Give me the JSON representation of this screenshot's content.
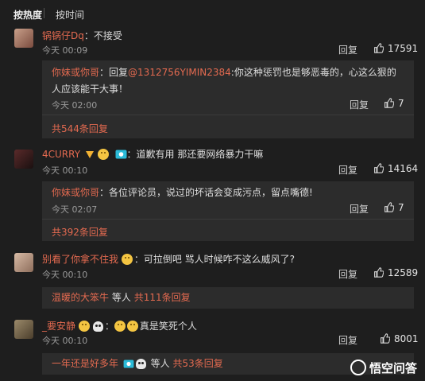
{
  "sort_tabs": {
    "hot": "按热度",
    "time": "按时间"
  },
  "comments": [
    {
      "name": "锅锅仔Dq",
      "colon": "：",
      "text": "不接受",
      "time": "今天 00:09",
      "reply_label": "回复",
      "likes": "17591",
      "reply_box": {
        "author": "你妹或你哥",
        "colon": "：",
        "prefix": "回复",
        "mention": "@1312756YIMIN2384",
        "text": ":你这种惩罚也是够恶毒的，心这么狠的人应该能干大事！",
        "time": "今天 02:00",
        "reply_label": "回复",
        "likes": "7",
        "total": "共544条回复"
      }
    },
    {
      "name": "4CURRY",
      "colon": "：",
      "text": "道歉有用 那还要网络暴力干嘛",
      "time": "今天 00:10",
      "reply_label": "回复",
      "likes": "14164",
      "reply_box": {
        "author": "你妹或你哥",
        "colon": "：",
        "text": "各位评论员，说过的坏话会变成污点，留点嘴德!",
        "time": "今天 02:07",
        "reply_label": "回复",
        "likes": "7",
        "total": "共392条回复"
      }
    },
    {
      "name": "别看了你拿不住我",
      "colon": "：",
      "text": "可拉倒吧 骂人时候咋不这么威风了?",
      "time": "今天 00:10",
      "reply_label": "回复",
      "likes": "12589",
      "reply_summary": {
        "user": "温暖的大笨牛",
        "others": "等人",
        "count": "共111条回复"
      }
    },
    {
      "name": "_要安静",
      "colon": "：",
      "text": "真是笑死个人",
      "time": "今天 00:10",
      "reply_label": "回复",
      "likes": "8001",
      "reply_summary": {
        "user": "一年还是好多年",
        "others": "等人",
        "count": "共53条回复"
      }
    }
  ],
  "watermark": "悟空问答",
  "colors": {
    "accent": "#e36a50",
    "background": "#1e1e1e",
    "reply_box": "#2c2c2c"
  },
  "icons": [
    "thumbs-up-icon",
    "verified-badge-icon",
    "emoji-icon",
    "skull-icon",
    "wukong-logo-icon"
  ]
}
